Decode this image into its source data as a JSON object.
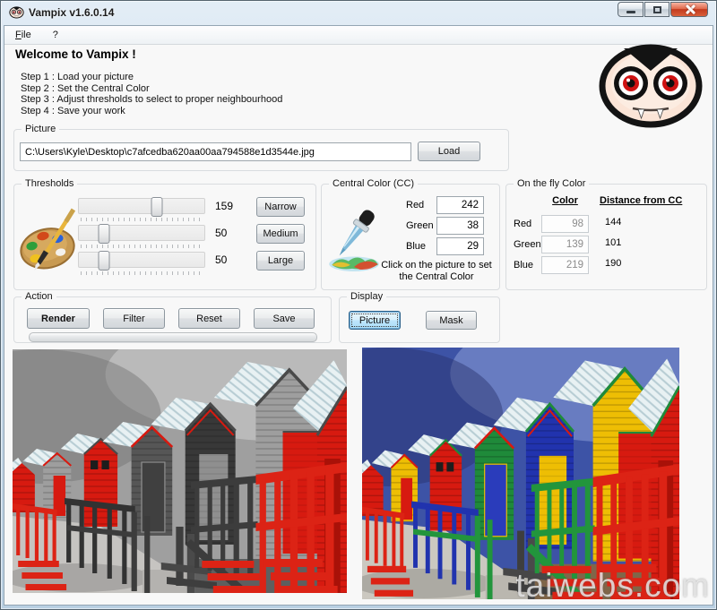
{
  "window": {
    "title": "Vampix v1.6.0.14",
    "controls": [
      {
        "name": "minimize"
      },
      {
        "name": "maximize"
      },
      {
        "name": "close"
      }
    ]
  },
  "menu": {
    "items": [
      {
        "label": "File"
      },
      {
        "label": "?"
      }
    ]
  },
  "welcome": {
    "title": "Welcome to Vampix !",
    "steps": [
      "Step 1 : Load your picture",
      "Step 2 : Set the Central Color",
      "Step 3 : Adjust thresholds to select to proper neighbourhood",
      "Step 4 : Save your work"
    ]
  },
  "picture": {
    "label": "Picture",
    "path": "C:\\Users\\Kyle\\Desktop\\c7afcedba620aa00aa794588e1d3544e.jpg",
    "load_label": "Load"
  },
  "thresholds": {
    "label": "Thresholds",
    "sliders": [
      {
        "value": "159",
        "pos": "62%"
      },
      {
        "value": "50",
        "pos": "20%"
      },
      {
        "value": "50",
        "pos": "20%"
      }
    ],
    "buttons": [
      "Narrow",
      "Medium",
      "Large"
    ]
  },
  "central_color": {
    "label": "Central Color (CC)",
    "rows": [
      {
        "name": "Red",
        "value": "242"
      },
      {
        "name": "Green",
        "value": "38"
      },
      {
        "name": "Blue",
        "value": "29"
      }
    ],
    "hint": "Click on the picture to set the Central Color",
    "rgb": "rgb(242,38,29)"
  },
  "on_the_fly": {
    "label": "On the fly Color",
    "col_color": "Color",
    "col_distance": "Distance from CC",
    "rows": [
      {
        "name": "Red",
        "value": "98",
        "distance": "144"
      },
      {
        "name": "Green",
        "value": "139",
        "distance": "101"
      },
      {
        "name": "Blue",
        "value": "219",
        "distance": "190"
      }
    ],
    "rgb": "rgb(98,139,219)"
  },
  "action": {
    "label": "Action",
    "buttons": [
      "Render",
      "Filter",
      "Reset",
      "Save"
    ]
  },
  "display": {
    "label": "Display",
    "picture_label": "Picture",
    "mask_label": "Mask"
  },
  "watermark": "taiwebs.com",
  "colors": {
    "close_button": "#c23a1e",
    "focus_blue": "#2c628b",
    "preserved_red": "#d71a10"
  }
}
